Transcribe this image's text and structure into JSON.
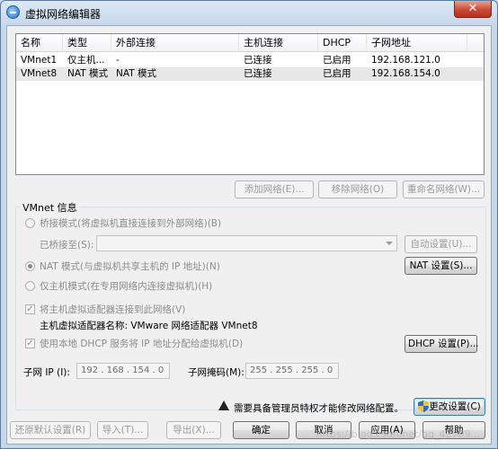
{
  "window": {
    "title": "虚拟网络编辑器",
    "close_glyph": "✕"
  },
  "table": {
    "columns": [
      "名称",
      "类型",
      "外部连接",
      "主机连接",
      "DHCP",
      "子网地址"
    ],
    "rows": [
      [
        "VMnet1",
        "仅主机...",
        "-",
        "已连接",
        "已启用",
        "192.168.121.0"
      ],
      [
        "VMnet8",
        "NAT 模式",
        "NAT 模式",
        "已连接",
        "已启用",
        "192.168.154.0"
      ]
    ],
    "selected_row": 1
  },
  "list_buttons": {
    "add": "添加网络(E)...",
    "remove": "移除网络(O)",
    "rename": "重命名网络(W)..."
  },
  "vmnet_info": {
    "group_label": "VMnet 信息",
    "bridged_label": "桥接模式(将虚拟机直接连接到外部网络)(B)",
    "bridged_to_label": "已桥接至(S):",
    "bridged_to_value": "",
    "auto_settings": "自动设置(U)...",
    "nat_label": "NAT 模式(与虚拟机共享主机的 IP 地址)(N)",
    "nat_settings": "NAT 设置(S)...",
    "hostonly_label": "仅主机模式(在专用网络内连接虚拟机)(H)",
    "connect_adapter_label": "将主机虚拟适配器连接到此网络(V)",
    "adapter_name_label": "主机虚拟适配器名称: VMware 网络适配器 VMnet8",
    "dhcp_label": "使用本地 DHCP 服务将 IP 地址分配给虚拟机(D)",
    "dhcp_settings": "DHCP 设置(P)...",
    "subnet_ip_label": "子网 IP (I):",
    "subnet_ip_value": "192 . 168 . 154 .  0",
    "subnet_mask_label": "子网掩码(M):",
    "subnet_mask_value": "255 . 255 . 255 .  0"
  },
  "admin": {
    "notice": "需要具备管理员特权才能修改网络配置。",
    "change_settings": "更改设置(C)"
  },
  "footer": {
    "restore": "还原默认设置(R)",
    "import": "导入(T)...",
    "export": "导出(X)...",
    "ok": "确定",
    "cancel": "取消",
    "apply": "应用(A)",
    "help": "帮助"
  },
  "watermark": "https://blog.csdn.net/qq_42709..."
}
